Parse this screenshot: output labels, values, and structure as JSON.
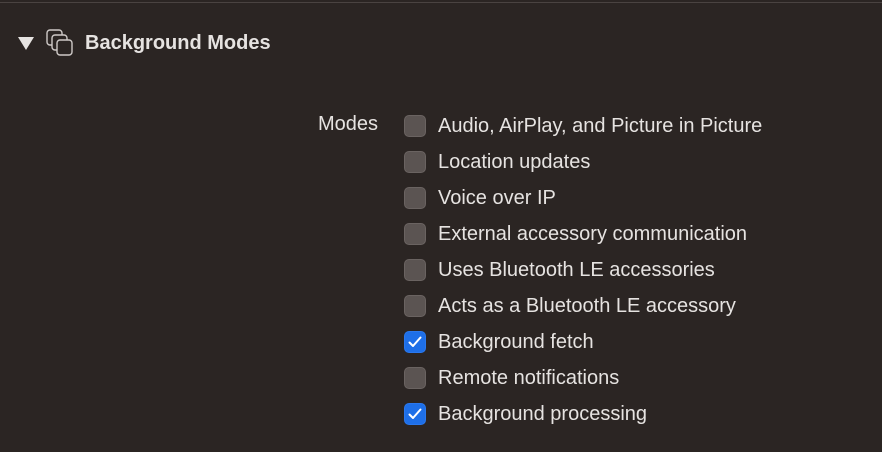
{
  "section": {
    "title": "Background Modes",
    "expanded": true,
    "icon": "stacked-windows-icon"
  },
  "modes": {
    "label": "Modes",
    "items": [
      {
        "label": "Audio, AirPlay, and Picture in Picture",
        "checked": false
      },
      {
        "label": "Location updates",
        "checked": false
      },
      {
        "label": "Voice over IP",
        "checked": false
      },
      {
        "label": "External accessory communication",
        "checked": false
      },
      {
        "label": "Uses Bluetooth LE accessories",
        "checked": false
      },
      {
        "label": "Acts as a Bluetooth LE accessory",
        "checked": false
      },
      {
        "label": "Background fetch",
        "checked": true
      },
      {
        "label": "Remote notifications",
        "checked": false
      },
      {
        "label": "Background processing",
        "checked": true
      }
    ]
  },
  "colors": {
    "background": "#2b2523",
    "text": "#e6e3e1",
    "checkbox_off": "#5b5452",
    "checkbox_on": "#1e6fe8"
  }
}
